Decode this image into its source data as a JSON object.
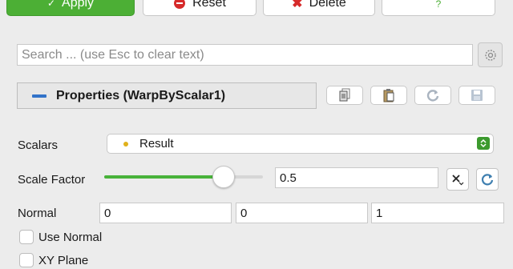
{
  "toolbar": {
    "apply_label": "Apply",
    "reset_label": "Reset",
    "delete_label": "Delete",
    "help_label": "?"
  },
  "search": {
    "placeholder": "Search ... (use Esc to clear text)"
  },
  "properties": {
    "title": "Properties (WarpByScalar1)"
  },
  "scalars": {
    "label": "Scalars",
    "value": "Result"
  },
  "scale_factor": {
    "label": "Scale Factor",
    "value": "0.5",
    "slider_fraction": 0.75
  },
  "normal": {
    "label": "Normal",
    "x": "0",
    "y": "0",
    "z": "1"
  },
  "use_normal": {
    "label": "Use Normal",
    "checked": false
  },
  "xy_plane": {
    "label": "XY Plane",
    "checked": false
  },
  "colors": {
    "apply_green": "#4caf35",
    "accent_blue": "#3273c9",
    "reset_red": "#d62a2a",
    "slider_green": "#48b23a"
  }
}
